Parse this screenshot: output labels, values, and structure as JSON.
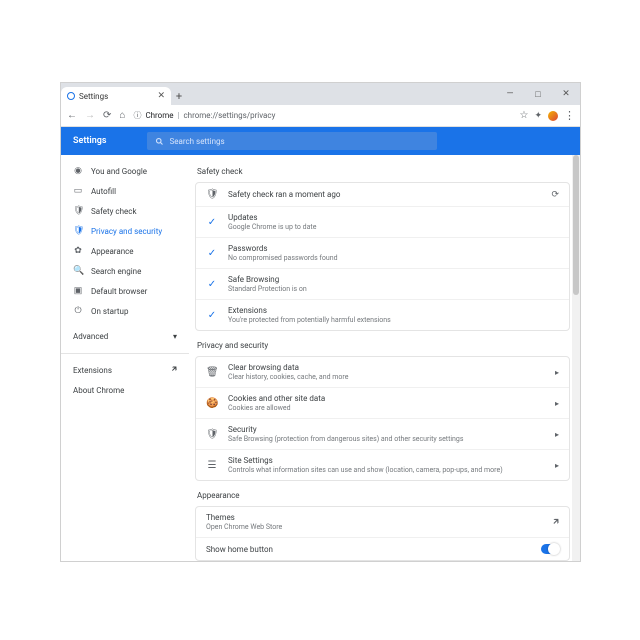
{
  "window": {
    "tab_title": "Settings",
    "new_tab_tooltip": "+",
    "win_min": "—",
    "win_max": "□",
    "win_close": "✕"
  },
  "address": {
    "back": "←",
    "forward": "→",
    "reload": "⟳",
    "home": "⌂",
    "scheme_label": "Chrome",
    "url": "chrome://settings/privacy",
    "star": "☆",
    "menu": "⋮"
  },
  "header": {
    "title": "Settings",
    "search_placeholder": "Search settings"
  },
  "sidebar": {
    "items": [
      {
        "icon": "person",
        "label": "You and Google"
      },
      {
        "icon": "autofill",
        "label": "Autofill"
      },
      {
        "icon": "shield",
        "label": "Safety check"
      },
      {
        "icon": "privacy",
        "label": "Privacy and security"
      },
      {
        "icon": "appearance",
        "label": "Appearance"
      },
      {
        "icon": "search",
        "label": "Search engine"
      },
      {
        "icon": "default",
        "label": "Default browser"
      },
      {
        "icon": "startup",
        "label": "On startup"
      }
    ],
    "advanced": "Advanced",
    "extensions": "Extensions",
    "about": "About Chrome"
  },
  "sections": {
    "safety_title": "Safety check",
    "safety_rows": [
      {
        "icon": "shield",
        "title": "Safety check ran a moment ago",
        "sub": "",
        "tail": "reload"
      },
      {
        "icon": "check",
        "title": "Updates",
        "sub": "Google Chrome is up to date"
      },
      {
        "icon": "check",
        "title": "Passwords",
        "sub": "No compromised passwords found"
      },
      {
        "icon": "check",
        "title": "Safe Browsing",
        "sub": "Standard Protection is on"
      },
      {
        "icon": "check",
        "title": "Extensions",
        "sub": "You're protected from potentially harmful extensions"
      }
    ],
    "privacy_title": "Privacy and security",
    "privacy_rows": [
      {
        "icon": "trash",
        "title": "Clear browsing data",
        "sub": "Clear history, cookies, cache, and more"
      },
      {
        "icon": "cookie",
        "title": "Cookies and other site data",
        "sub": "Cookies are allowed"
      },
      {
        "icon": "security",
        "title": "Security",
        "sub": "Safe Browsing (protection from dangerous sites) and other security settings"
      },
      {
        "icon": "sliders",
        "title": "Site Settings",
        "sub": "Controls what information sites can use and show (location, camera, pop-ups, and more)"
      }
    ],
    "appearance_title": "Appearance",
    "appearance_rows": [
      {
        "title": "Themes",
        "sub": "Open Chrome Web Store",
        "tail": "open"
      },
      {
        "title": "Show home button",
        "sub": "",
        "tail": "toggle"
      }
    ]
  }
}
